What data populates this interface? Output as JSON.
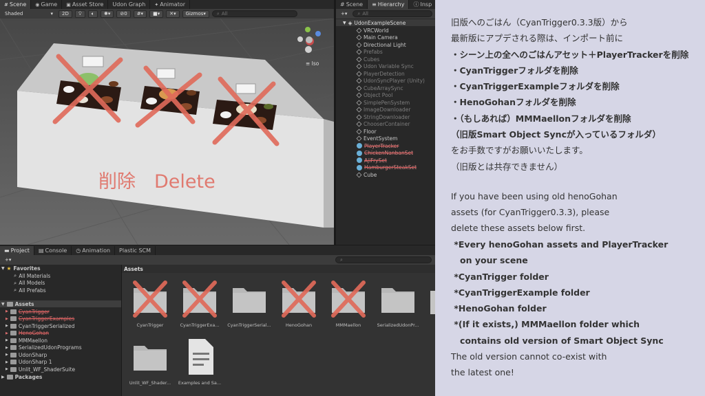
{
  "scene_panel": {
    "tabs": [
      "Scene",
      "Game",
      "Asset Store",
      "Udon Graph",
      "Animator"
    ],
    "shading_mode": "Shaded",
    "mode_2d": "2D",
    "gizmos_label": "Gizmos",
    "search_placeholder": "All",
    "hidden_count": "0",
    "view_label": "Iso",
    "overlay_text": "削除　Delete"
  },
  "hierarchy_panel": {
    "tabs": [
      "Scene",
      "Hierarchy",
      "Insp"
    ],
    "search_placeholder": "All",
    "root": "UdonExampleScene",
    "items": [
      {
        "label": "VRCWorld",
        "state": "normal"
      },
      {
        "label": "Main Camera",
        "state": "normal"
      },
      {
        "label": "Directional Light",
        "state": "normal"
      },
      {
        "label": "Prefabs",
        "state": "disabled"
      },
      {
        "label": "Cubes",
        "state": "disabled"
      },
      {
        "label": "Udon Variable Sync",
        "state": "disabled"
      },
      {
        "label": "PlayerDetection",
        "state": "disabled"
      },
      {
        "label": "UdonSyncPlayer (Unity)",
        "state": "disabled"
      },
      {
        "label": "CubeArraySync",
        "state": "disabled"
      },
      {
        "label": "Object Pool",
        "state": "disabled"
      },
      {
        "label": "SimplePenSystem",
        "state": "disabled"
      },
      {
        "label": "ImageDownloader",
        "state": "disabled"
      },
      {
        "label": "StringDownloader",
        "state": "disabled"
      },
      {
        "label": "ChooserContainer",
        "state": "disabled"
      },
      {
        "label": "Floor",
        "state": "normal"
      },
      {
        "label": "EventSystem",
        "state": "normal"
      },
      {
        "label": "PlayerTracker",
        "state": "struck"
      },
      {
        "label": "ChickenNanbanSet",
        "state": "struck"
      },
      {
        "label": "AjiFrySet",
        "state": "struck"
      },
      {
        "label": "HamburgerSteakSet",
        "state": "struck"
      },
      {
        "label": "Cube",
        "state": "normal"
      }
    ]
  },
  "project_panel": {
    "tabs": [
      "Project",
      "Console",
      "Animation",
      "Plastic SCM"
    ],
    "favorites_label": "Favorites",
    "favorites": [
      "All Materials",
      "All Models",
      "All Prefabs"
    ],
    "assets_label": "Assets",
    "tree": [
      {
        "label": "CyanTrigger",
        "struck": true
      },
      {
        "label": "CyanTriggerExamples",
        "struck": true
      },
      {
        "label": "CyanTriggerSerialized",
        "struck": false
      },
      {
        "label": "HenoGohan",
        "struck": true
      },
      {
        "label": "MMMaellon",
        "struck": false
      },
      {
        "label": "SerializedUdonPrograms",
        "struck": false
      },
      {
        "label": "UdonSharp",
        "struck": false
      },
      {
        "label": "UdonSharp 1",
        "struck": false
      },
      {
        "label": "Unlit_WF_ShaderSuite",
        "struck": false
      }
    ],
    "packages_label": "Packages",
    "breadcrumb": "Assets",
    "assets": [
      {
        "label": "CyanTrigger",
        "crossed": true,
        "kind": "folder"
      },
      {
        "label": "CyanTriggerExa...",
        "crossed": true,
        "kind": "folder"
      },
      {
        "label": "CyanTriggerSerial...",
        "crossed": false,
        "kind": "folder"
      },
      {
        "label": "HenoGohan",
        "crossed": true,
        "kind": "folder"
      },
      {
        "label": "MMMaellon",
        "crossed": true,
        "kind": "folder"
      },
      {
        "label": "SerializedUdonPr...",
        "crossed": false,
        "kind": "folder"
      },
      {
        "label": "Unlit_WF_Shader...",
        "crossed": false,
        "kind": "folder"
      },
      {
        "label": "Examples and Sa...",
        "crossed": false,
        "kind": "doc"
      }
    ]
  },
  "notes": {
    "lines": [
      {
        "text": "旧版へのごはん（CyanTrigger0.3.3版）から",
        "bold": false
      },
      {
        "text": "最新版にアプデされる際は、インポート前に",
        "bold": false
      },
      {
        "text": "・シーン上の全へのごはんアセット＋PlayerTrackerを削除",
        "bold": true
      },
      {
        "text": "・CyanTriggerフォルダを削除",
        "bold": true
      },
      {
        "text": "・CyanTriggerExampleフォルダを削除",
        "bold": true
      },
      {
        "text": "・HenoGohanフォルダを削除",
        "bold": true
      },
      {
        "text": "・（もしあれば）MMMaellonフォルダを削除",
        "bold": true
      },
      {
        "text": "（旧版Smart Object Syncが入っているフォルダ）",
        "bold": true
      },
      {
        "text": "をお手数ですがお願いいたします。",
        "bold": false
      },
      {
        "text": "（旧版とは共存できません）",
        "bold": false
      },
      {
        "text": "If you have been using old henoGohan",
        "bold": false
      },
      {
        "text": "assets (for CyanTrigger0.3.3), please",
        "bold": false
      },
      {
        "text": "delete these assets below first.",
        "bold": false
      },
      {
        "text": " *Every henoGohan assets and PlayerTracker",
        "bold": true
      },
      {
        "text": "   on your scene",
        "bold": true
      },
      {
        "text": " *CyanTrigger folder",
        "bold": true
      },
      {
        "text": " *CyanTriggerExample folder",
        "bold": true
      },
      {
        "text": " *HenoGohan folder",
        "bold": true
      },
      {
        "text": " *(If it exists,) MMMaellon folder which",
        "bold": true
      },
      {
        "text": "   contains old version of Smart Object Sync",
        "bold": true
      },
      {
        "text": "The old version cannot co-exist with",
        "bold": false
      },
      {
        "text": "the latest one!",
        "bold": false
      }
    ]
  },
  "colors": {
    "cross": "#e06a5a",
    "notes_bg": "#d6d6e6",
    "editor_bg": "#282828"
  }
}
